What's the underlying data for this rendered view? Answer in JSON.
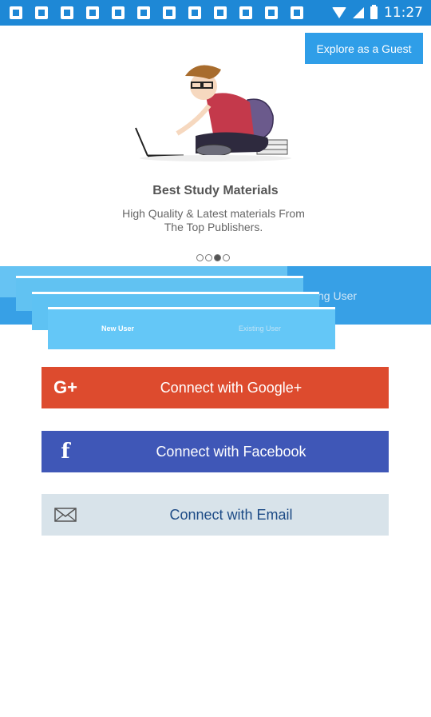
{
  "status_bar": {
    "time": "11:27",
    "colors": {
      "background": "#1e88d6"
    }
  },
  "guest_button": {
    "label": "Explore as a Guest"
  },
  "slide": {
    "title": "Best Study Materials",
    "subtitle_line1": "High Quality & Latest materials From",
    "subtitle_line2": "The Top Publishers.",
    "illustration": "student-with-laptop-illustration",
    "pages": 4,
    "active_page": 3
  },
  "tabs": {
    "new_user": "New User",
    "existing_user": "Existing User",
    "existing_user_partial": "ng User"
  },
  "buttons": {
    "google": {
      "label": "Connect with Google+",
      "icon": "google-plus-icon",
      "color": "#dd4b2e"
    },
    "facebook": {
      "label": "Connect with Facebook",
      "icon": "facebook-icon",
      "color": "#3f57b7"
    },
    "email": {
      "label": "Connect with Email",
      "icon": "mail-icon",
      "color": "#d8e3ea"
    }
  }
}
